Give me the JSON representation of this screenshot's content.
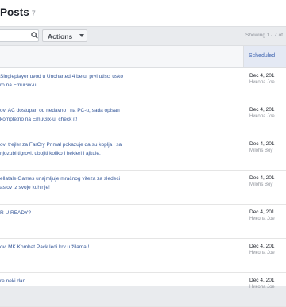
{
  "header": {
    "title": "Posts",
    "count": "7"
  },
  "toolbar": {
    "actions_label": "Actions",
    "showing_text": "Showing 1 - 7 of"
  },
  "table": {
    "columns": {
      "scheduled": "Scheduled"
    },
    "rows": [
      {
        "title": "Singleplayer uvod u Uncharted 4 betu, prvi utisci usko\nro na EmuGix-u.",
        "date": "Dec 4, 201",
        "author": "Никола Јое"
      },
      {
        "title": "ovi AC dostupan od nedavno i na PC-u, sada opisan\nkompletno na EmuGix-u, check it!",
        "date": "Dec 4, 201",
        "author": "Никола Јое"
      },
      {
        "title": "ovi trejler za FarCry Primal pokazuje da su koplja i sa\nnjozubi tigrovi, ubojiti koliko i hekleri i ajkule.",
        "date": "Dec 4, 201",
        "author": "Milohs Boy"
      },
      {
        "title": "ellatale Games unajmljuje mračnog viteza za sledeći\nasiov iz svoje kuhinje!",
        "date": "Dec 4, 201",
        "author": "Milohs Boy"
      },
      {
        "title": "R U READY?",
        "date": "Dec 4, 201",
        "author": "Никола Јое"
      },
      {
        "title": "ovi MK Kombat Pack ledi krv u žilama!!",
        "date": "Dec 4, 201",
        "author": "Никола Јое"
      },
      {
        "title": "re neki dan...",
        "date": "Dec 4, 201",
        "author": "Никола Јое"
      }
    ]
  }
}
